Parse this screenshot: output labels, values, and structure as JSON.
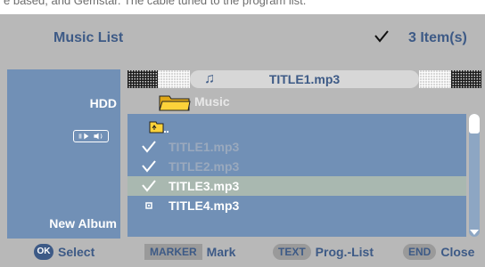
{
  "top_fragment": "e based, and Gemstar. The cable tuned to the program list.",
  "header": {
    "title": "Music List",
    "item_count": "3 Item(s)"
  },
  "side_panel": {
    "source": "HDD",
    "new_album": "New Album"
  },
  "now_playing": {
    "title": "TITLE1.mp3"
  },
  "folder": {
    "name": "Music"
  },
  "list": {
    "up_label": "..",
    "items": [
      {
        "label": "TITLE1.mp3",
        "checked": true
      },
      {
        "label": "TITLE2.mp3",
        "checked": true
      },
      {
        "label": "TITLE3.mp3",
        "checked": true
      },
      {
        "label": "TITLE4.mp3",
        "checked": false
      }
    ]
  },
  "hints": [
    {
      "key": "OK",
      "label": "Select"
    },
    {
      "key": "MARKER",
      "label": "Mark"
    },
    {
      "key": "TEXT",
      "label": "Prog.-List"
    },
    {
      "key": "END",
      "label": "Close"
    }
  ],
  "colors": {
    "background": "#b8b8b8",
    "panel_blue": "#7190b6",
    "text_blue": "#3d5a86",
    "selection": "#a9b8b0"
  }
}
